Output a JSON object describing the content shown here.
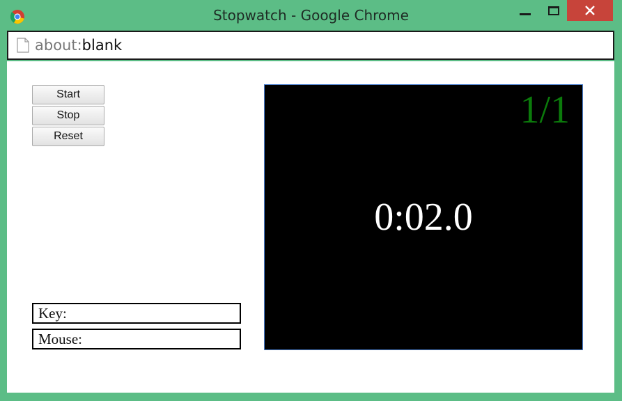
{
  "window": {
    "title": "Stopwatch - Google Chrome",
    "controls": {
      "minimize_icon": "minimize-icon",
      "maximize_icon": "maximize-icon",
      "close_icon": "close-icon"
    }
  },
  "address_bar": {
    "icon": "page-icon",
    "url_scheme": "about:",
    "url_path": "blank"
  },
  "controls": {
    "start_label": "Start",
    "stop_label": "Stop",
    "reset_label": "Reset"
  },
  "inputs": {
    "key_label": "Key:",
    "mouse_label": "Mouse:"
  },
  "display": {
    "counter": "1/1",
    "time": "0:02.0"
  },
  "colors": {
    "frame": "#5cbd86",
    "close_button": "#c7443a",
    "display_bg": "#000000",
    "counter_text": "#0b7a0b",
    "time_text": "#ffffff"
  }
}
